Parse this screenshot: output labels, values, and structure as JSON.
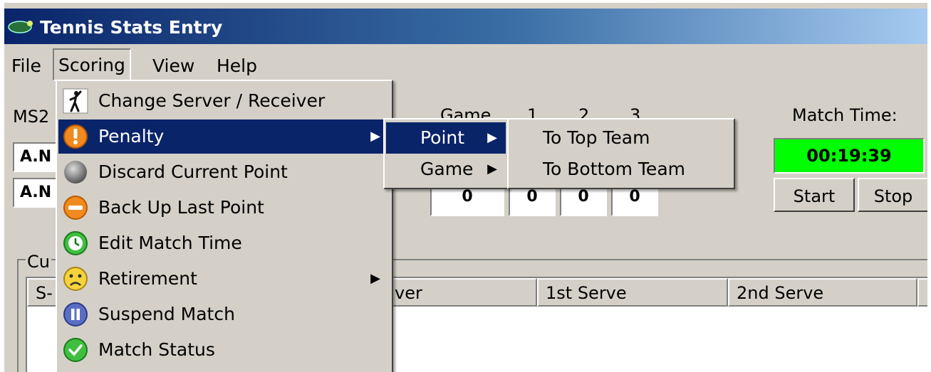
{
  "window": {
    "title": "Tennis Stats Entry"
  },
  "menubar": {
    "file": "File",
    "scoring": "Scoring",
    "view": "View",
    "help": "Help"
  },
  "match": {
    "code": "MS2",
    "team_top": "A.N",
    "team_bottom": "A.N",
    "game_header": "Game",
    "set_headers": [
      "1",
      "2",
      "3"
    ],
    "bottom_scores": [
      "0",
      "0",
      "0",
      "0"
    ],
    "time_label": "Match Time:",
    "time_value": "00:19:39",
    "start_label": "Start",
    "stop_label": "Stop"
  },
  "group": {
    "label": "Cu"
  },
  "list_columns": [
    "S-",
    "ver",
    "1st Serve",
    "2nd Serve",
    ""
  ],
  "scoring_menu": [
    {
      "label": "Change Server / Receiver",
      "icon": "server-player-icon"
    },
    {
      "label": "Penalty",
      "icon": "warning-icon",
      "submenu": true,
      "highlighted": true
    },
    {
      "label": "Discard Current Point",
      "icon": "gray-ball-icon"
    },
    {
      "label": "Back Up Last Point",
      "icon": "minus-icon"
    },
    {
      "label": "Edit Match Time",
      "icon": "clock-icon"
    },
    {
      "label": "Retirement",
      "icon": "sad-face-icon",
      "submenu": true
    },
    {
      "label": "Suspend Match",
      "icon": "pause-icon"
    },
    {
      "label": "Match Status",
      "icon": "check-icon"
    }
  ],
  "penalty_submenu": [
    {
      "label": "Point",
      "highlighted": true
    },
    {
      "label": "Game"
    }
  ],
  "point_submenu": [
    {
      "label": "To Top Team"
    },
    {
      "label": "To Bottom Team"
    }
  ],
  "colors": {
    "title_start": "#0a246a",
    "title_end": "#a6caf0",
    "highlight": "#0a246a",
    "timer_bg": "#00ff00",
    "face": "#d4d0c8"
  }
}
